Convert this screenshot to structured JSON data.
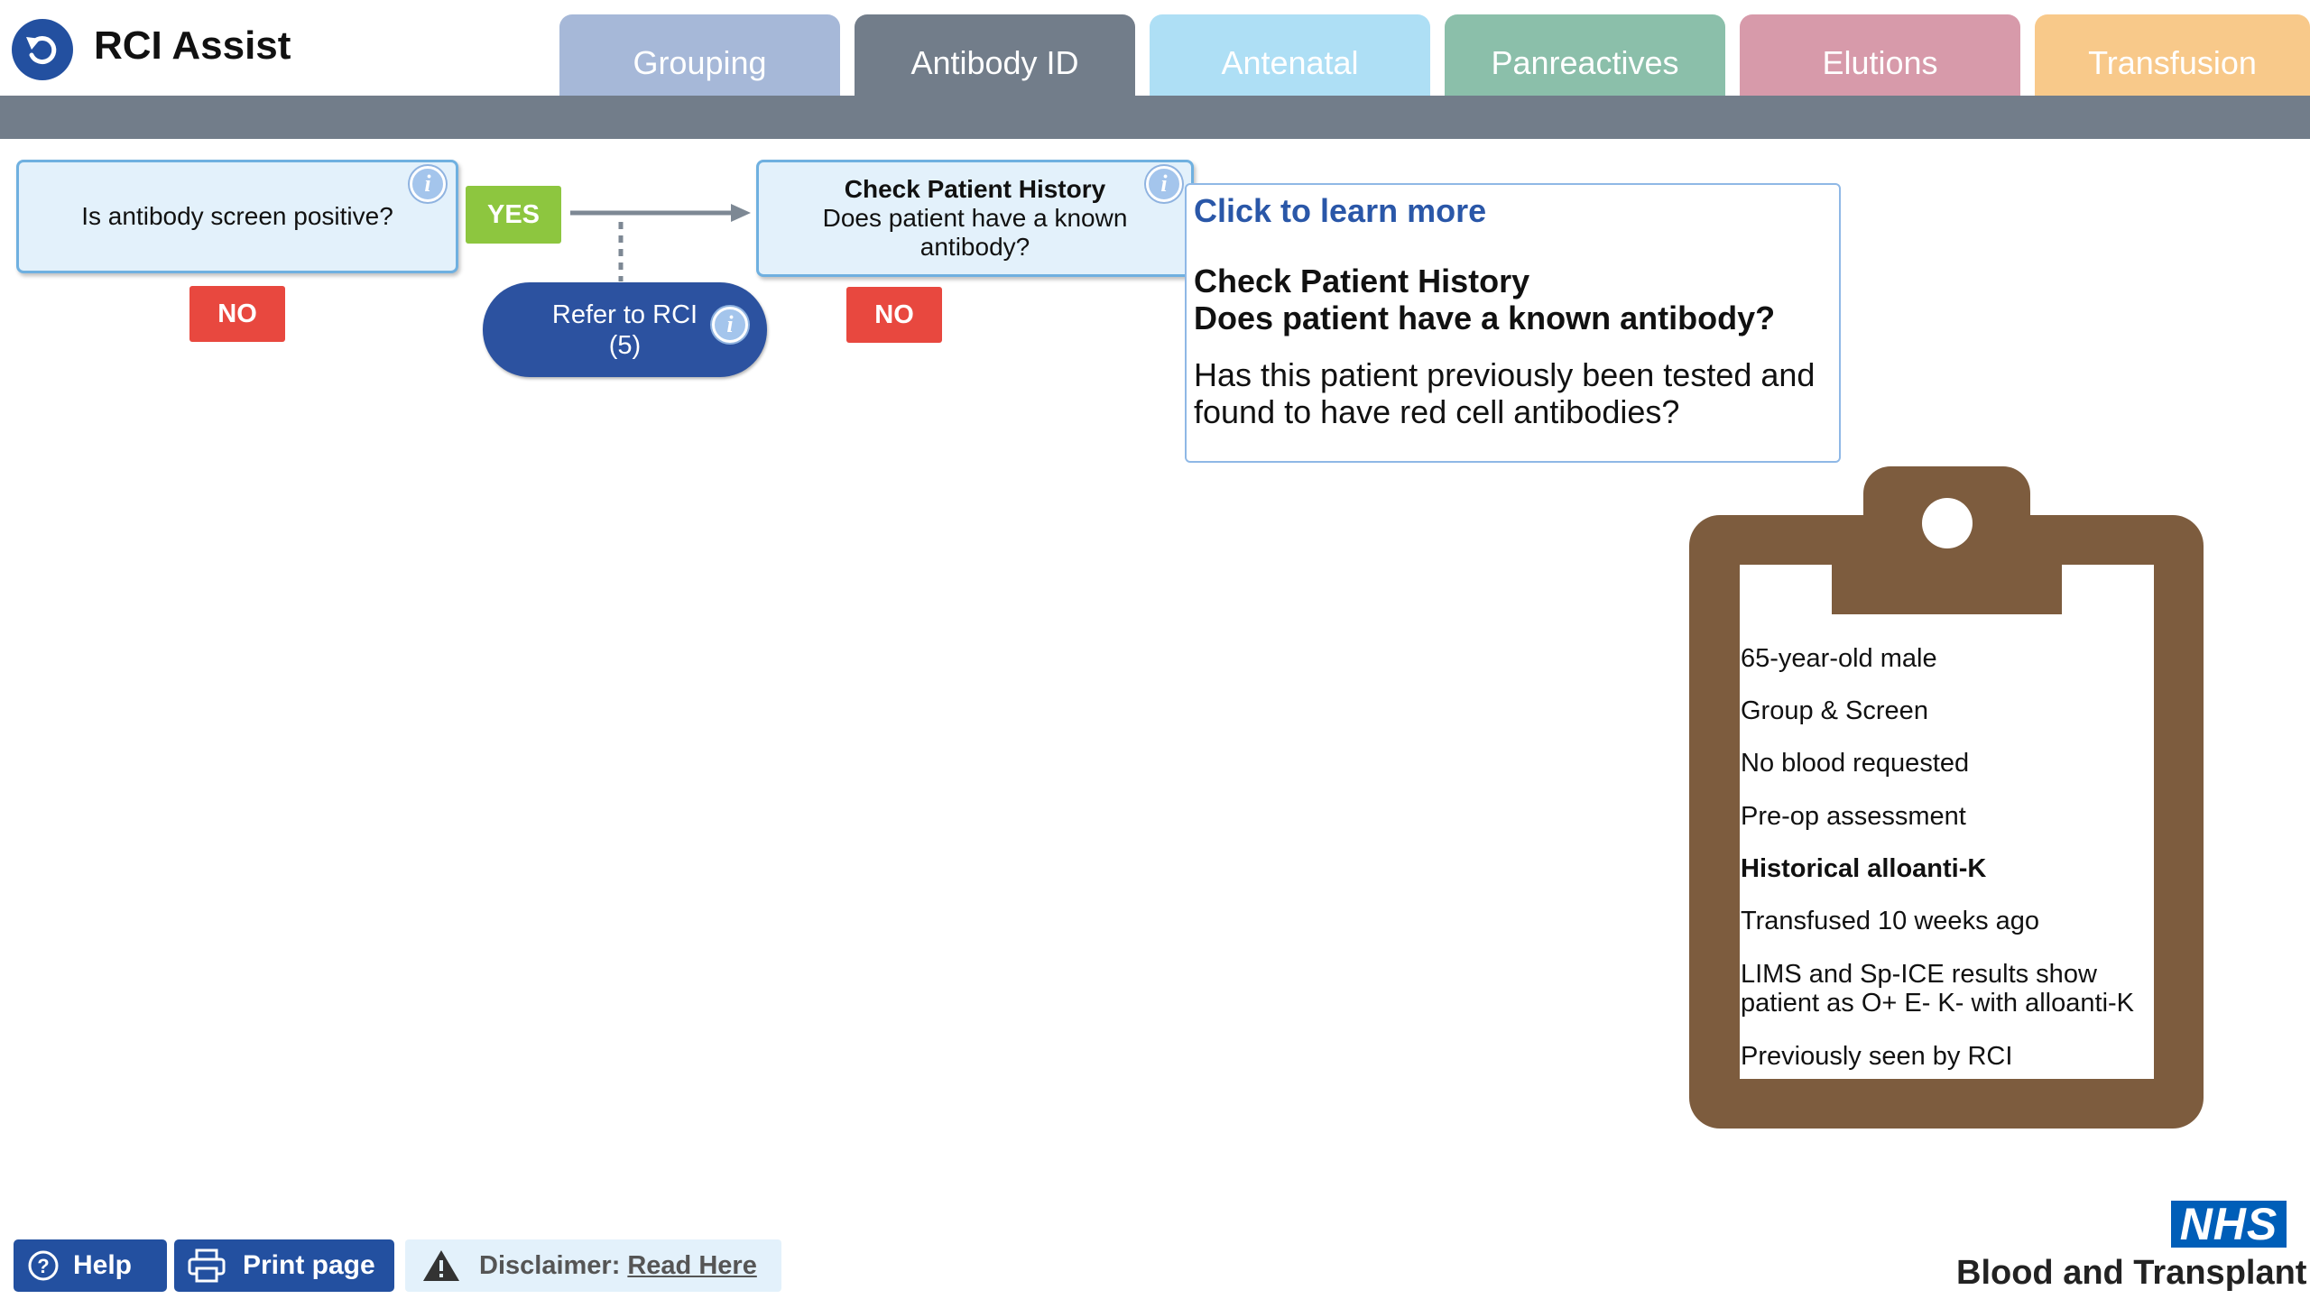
{
  "header": {
    "app_title": "RCI Assist",
    "tabs": [
      {
        "label": "Grouping",
        "color": "#a6b8d8"
      },
      {
        "label": "Antibody ID",
        "color": "#727d8a"
      },
      {
        "label": "Antenatal",
        "color": "#aedff5"
      },
      {
        "label": "Panreactives",
        "color": "#8bbfaa"
      },
      {
        "label": "Elutions",
        "color": "#d79aaa"
      },
      {
        "label": "Transfusion",
        "color": "#f8c98a"
      }
    ],
    "active_tab": "Antibody ID"
  },
  "flow": {
    "q1": {
      "text": "Is antibody screen positive?"
    },
    "yes_label": "YES",
    "no_label_1": "NO",
    "no_label_2": "NO",
    "refer": {
      "line1": "Refer to RCI",
      "line2": "(5)"
    },
    "q2": {
      "title": "Check Patient History",
      "text": "Does patient have a known antibody?"
    },
    "info_glyph": "i"
  },
  "tooltip": {
    "link": "Click to learn more",
    "heading1": "Check Patient History",
    "heading2": "Does patient have a known antibody?",
    "body": "Has this patient previously been tested and found to have red cell antibodies?"
  },
  "clipboard": {
    "items": [
      "65-year-old male",
      "Group & Screen",
      "No blood requested",
      "Pre-op assessment",
      "Historical alloanti-K",
      "Transfused 10 weeks ago",
      "LIMS and Sp-ICE results show patient as O+ E- K- with alloanti-K",
      "Previously seen by RCI"
    ],
    "bold_item": "Historical alloanti-K"
  },
  "footer": {
    "help": "Help",
    "print": "Print page",
    "disclaimer_label": "Disclaimer:",
    "disclaimer_link": "Read Here",
    "nhs_logo": "NHS",
    "nhs_org": "Blood and Transplant"
  },
  "colors": {
    "primary_blue": "#2350a0",
    "yes_green": "#8dc63f",
    "no_red": "#e8483f",
    "clipboard_brown": "#7d5c3e"
  }
}
